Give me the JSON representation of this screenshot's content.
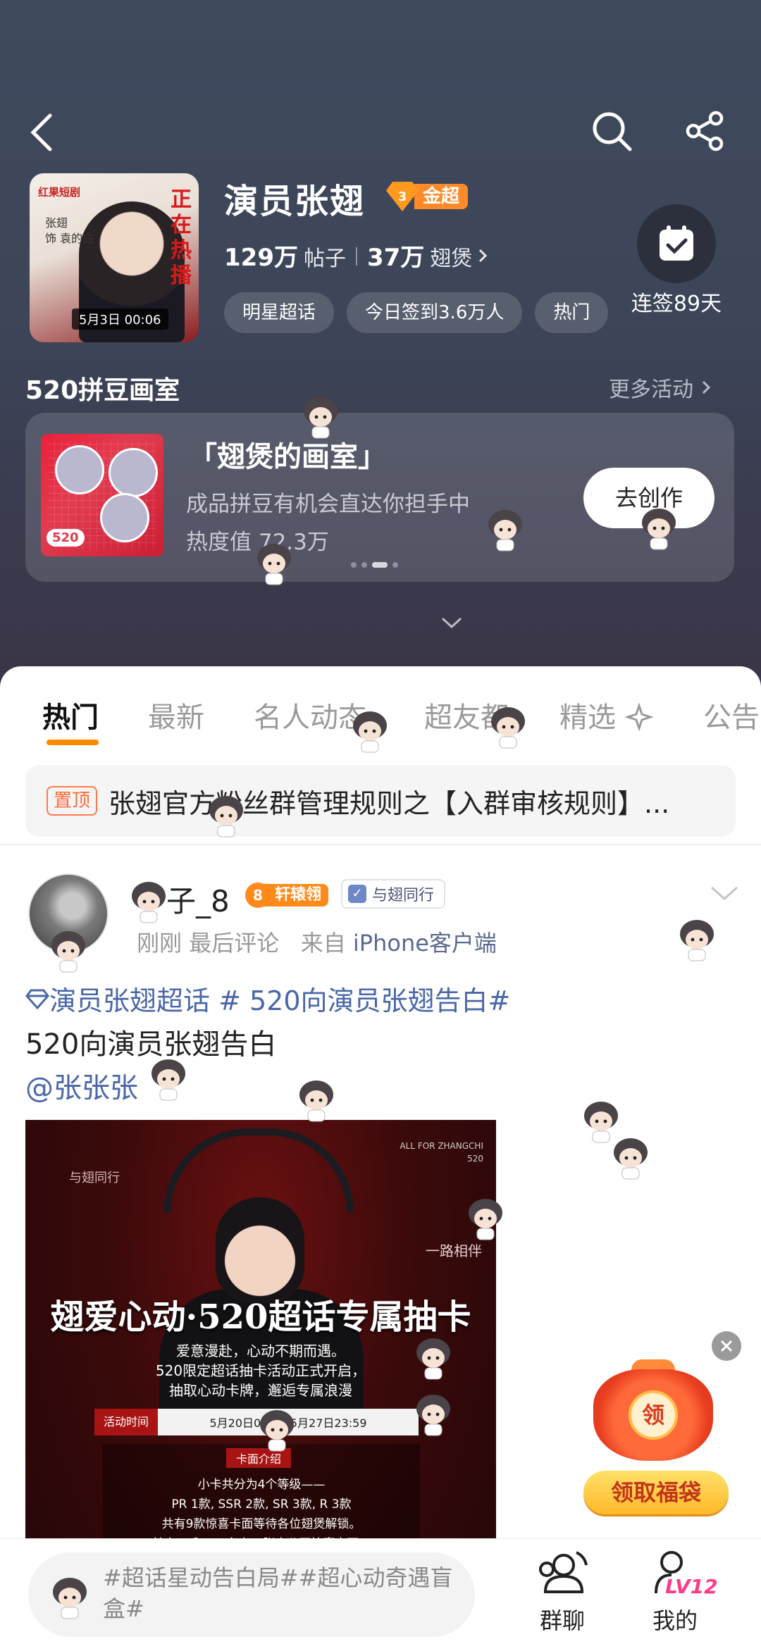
{
  "header": {
    "title": "演员张翅",
    "badge": {
      "level": "3",
      "label": "金超"
    },
    "posts_count": "129万",
    "posts_label": "帖子",
    "fans_count": "37万",
    "fans_label": "翅煲",
    "chips": [
      "明星超话",
      "今日签到3.6万人",
      "热门"
    ],
    "checkin_label": "连签89天"
  },
  "cover": {
    "brand": "红果短剧",
    "live_text": "正在热播",
    "names": [
      "张翅",
      "饰 袁的白"
    ],
    "time": "5月3日 00:06"
  },
  "activity": {
    "section_title": "520拼豆画室",
    "more_label": "更多活动",
    "card": {
      "title": "「翅煲的画室」",
      "subtitle": "成品拼豆有机会直达你担手中",
      "heat": "热度值 72.3万",
      "button": "去创作",
      "image_number": "520"
    }
  },
  "tabs": [
    "热门",
    "最新",
    "名人动态",
    "超友都",
    "精选",
    "公告"
  ],
  "pinned": {
    "badge": "置顶",
    "text": "张翅官方粉丝群管理规则之【入群审核规则】..."
  },
  "post": {
    "username": "子_8",
    "level_badge": {
      "level": "8",
      "label": "轩辕翎"
    },
    "tag_badge": "与翅同行",
    "time": "刚刚",
    "meta_action": "最后评论",
    "source_prefix": "来自",
    "source": "iPhone客户端",
    "topics": "演员张翅超话 # 520向演员张翅告白#",
    "text": "520向演员张翅告白",
    "mention": "@张张张"
  },
  "poster": {
    "top_left": "与翅同行",
    "top_right": [
      "ALL FOR ZHANGCHI",
      "520"
    ],
    "right_small": "一路相伴",
    "headline": "翅爱心动·520超话专属抽卡",
    "lines": [
      "爱意漫赴，心动不期而遇。",
      "520限定超话抽卡活动正式开启，",
      "抽取心动卡牌，邂逅专属浪漫"
    ],
    "time_label": "活动时间",
    "time_value": "5月20日00:00-5月27日23:59",
    "card_header": "卡面介绍",
    "card_lines": [
      "小卡共分为4个等级——",
      "PR 1款, SSR 2款, SR 3款, R 3款",
      "共有9款惊喜卡面等待各位翅煲解锁。",
      "其中PR和SSR各有一张未公开惊喜卡面。"
    ]
  },
  "float": {
    "bag_coin": "领",
    "bag_button": "领取福袋"
  },
  "bottom": {
    "comment_placeholder": "#超话星动告白局##超心动奇遇盲盒#",
    "nav": [
      {
        "label": "群聊",
        "icon": "group-chat-icon"
      },
      {
        "label": "我的",
        "icon": "profile-icon"
      }
    ],
    "level": "LV12"
  },
  "colors": {
    "accent": "#ff8a00",
    "link": "#4a67a8",
    "hero_bg": "#3d4558",
    "pin": "#ff6a3a",
    "lv": "#ff3a8a"
  }
}
